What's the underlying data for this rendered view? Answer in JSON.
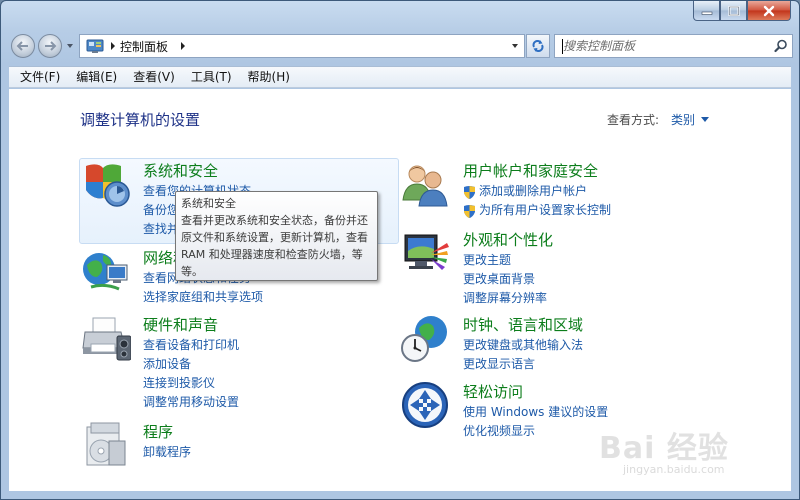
{
  "window": {
    "caption": {
      "minimize": "minimize",
      "maximize": "maximize",
      "close": "close"
    }
  },
  "address_bar": {
    "path_item": "控制面板",
    "search_placeholder": "搜索控制面板"
  },
  "menu": [
    "文件(F)",
    "编辑(E)",
    "查看(V)",
    "工具(T)",
    "帮助(H)"
  ],
  "content": {
    "title": "调整计算机的设置",
    "view_by_label": "查看方式:",
    "view_by_value": "类别"
  },
  "categories": [
    {
      "title": "系统和安全",
      "icon": "security-shield-icon",
      "links": [
        "查看您的计算机状态",
        "备份您的计算机",
        "查找并解决问题"
      ]
    },
    {
      "title": "网络和 Internet",
      "icon": "network-globe-icon",
      "links": [
        "查看网络状态和任务",
        "选择家庭组和共享选项"
      ]
    },
    {
      "title": "硬件和声音",
      "icon": "printer-icon",
      "links": [
        "查看设备和打印机",
        "添加设备",
        "连接到投影仪",
        "调整常用移动设置"
      ]
    },
    {
      "title": "程序",
      "icon": "programs-icon",
      "links": [
        "卸载程序"
      ]
    },
    {
      "title": "用户帐户和家庭安全",
      "icon": "users-icon",
      "links": [
        "添加或删除用户帐户",
        "为所有用户设置家长控制"
      ]
    },
    {
      "title": "外观和个性化",
      "icon": "appearance-monitor-icon",
      "links": [
        "更改主题",
        "更改桌面背景",
        "调整屏幕分辨率"
      ]
    },
    {
      "title": "时钟、语言和区域",
      "icon": "clock-globe-icon",
      "links": [
        "更改键盘或其他输入法",
        "更改显示语言"
      ]
    },
    {
      "title": "轻松访问",
      "icon": "ease-of-access-icon",
      "links": [
        "使用 Windows 建议的设置",
        "优化视频显示"
      ]
    }
  ],
  "tooltip": {
    "title": "系统和安全",
    "body": "查看并更改系统和安全状态，备份并还原文件和系统设置，更新计算机，查看 RAM 和处理器速度和检查防火墙，等等。"
  },
  "watermark": {
    "text": "Bai 经验",
    "sub": "jingyan.baidu.com"
  },
  "colors": {
    "link": "#1e5aa8",
    "category_title": "#0c7d1b",
    "page_title": "#1e3287"
  }
}
